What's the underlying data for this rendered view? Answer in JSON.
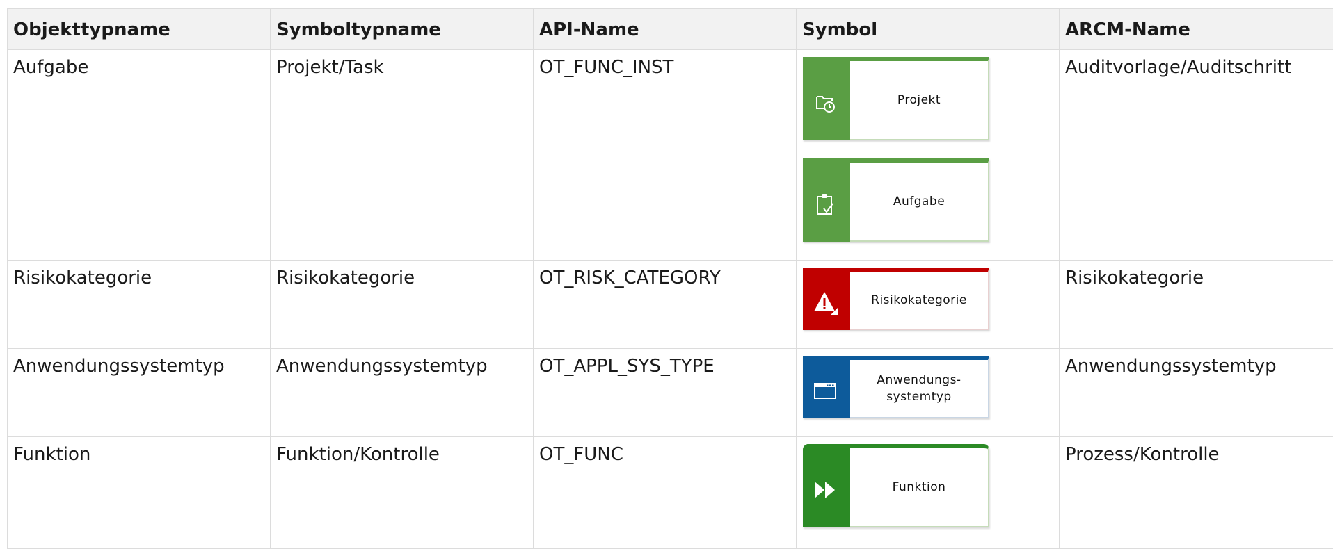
{
  "headers": [
    "Objekttypname",
    "Symboltypname",
    "API-Name",
    "Symbol",
    "ARCM-Name"
  ],
  "rows": [
    {
      "objekttyp": "Aufgabe",
      "symboltyp": "Projekt/Task",
      "api": "OT_FUNC_INST",
      "symbols": [
        {
          "label": "Projekt",
          "icon": "project-folder-clock-icon",
          "color": "#5a9e44"
        },
        {
          "label": "Aufgabe",
          "icon": "task-clipboard-check-icon",
          "color": "#5a9e44"
        }
      ],
      "arcm": "Auditvorlage/Auditschritt"
    },
    {
      "objekttyp": "Risikokategorie",
      "symboltyp": "Risikokategorie",
      "api": "OT_RISK_CATEGORY",
      "symbols": [
        {
          "label": "Risikokategorie",
          "icon": "warning-triangle-icon",
          "color": "#c00000"
        }
      ],
      "arcm": "Risikokategorie"
    },
    {
      "objekttyp": "Anwendungssystemtyp",
      "symboltyp": "Anwendungssystemtyp",
      "api": "OT_APPL_SYS_TYPE",
      "symbols": [
        {
          "label_line1": "Anwendungs-",
          "label_line2": "systemtyp",
          "icon": "application-window-icon",
          "color": "#0d5b9b"
        }
      ],
      "arcm": "Anwendungssystemtyp"
    },
    {
      "objekttyp": "Funktion",
      "symboltyp": "Funktion/Kontrolle",
      "api": "OT_FUNC",
      "symbols": [
        {
          "label": "Funktion",
          "icon": "fast-forward-icon",
          "color": "#2b8a25"
        }
      ],
      "arcm": "Prozess/Kontrolle"
    }
  ]
}
